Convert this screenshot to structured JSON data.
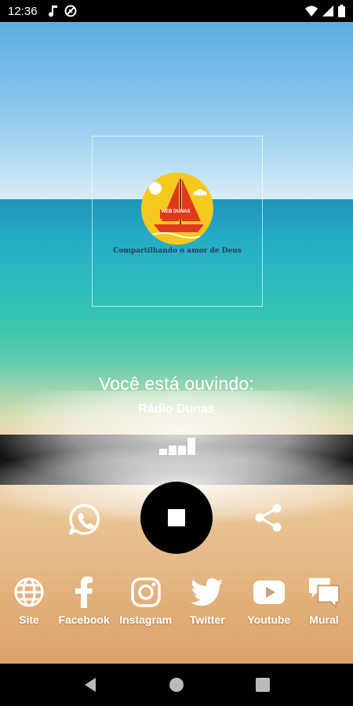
{
  "status_bar": {
    "time": "12:36",
    "left_icons": [
      "music-note-icon",
      "blocked-icon"
    ],
    "right_icons": [
      "wifi-icon",
      "cellular-signal-icon",
      "battery-icon"
    ]
  },
  "logo": {
    "caption": "Compartilhando o amor de Deus",
    "brand_text": "WEB DUNAS",
    "colors": {
      "circle": "#f7c81e",
      "sail": "#e03a1e"
    }
  },
  "player": {
    "listening_label": "Você está ouvindo:",
    "station_name": "Rádio Dunas",
    "level_icon": "audio-level-bars-icon",
    "stop_icon": "stop-icon",
    "whatsapp_icon": "whatsapp-icon",
    "share_icon": "share-icon"
  },
  "social": [
    {
      "label": "Site",
      "icon": "globe-icon"
    },
    {
      "label": "Facebook",
      "icon": "facebook-icon"
    },
    {
      "label": "Instagram",
      "icon": "instagram-icon"
    },
    {
      "label": "Twitter",
      "icon": "twitter-icon"
    },
    {
      "label": "Youtube",
      "icon": "youtube-icon"
    },
    {
      "label": "Mural",
      "icon": "chat-bubbles-icon"
    }
  ],
  "nav_bar": {
    "buttons": [
      "back-icon",
      "home-icon",
      "recents-icon"
    ]
  }
}
